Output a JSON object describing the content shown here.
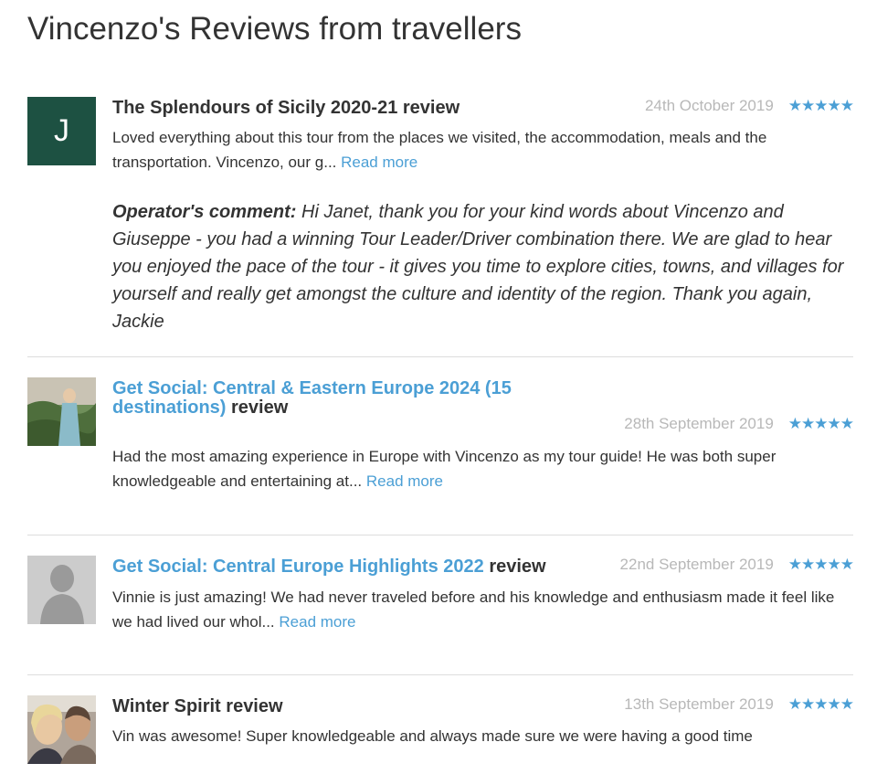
{
  "page_title": "Vincenzo's Reviews from travellers",
  "colors": {
    "accent": "#4b9fd5",
    "date": "#b8b8b8",
    "avatar_initial_bg": "#1d5142"
  },
  "reviews": [
    {
      "avatar_initial": "J",
      "tour_name": "The Splendours of Sicily 2020-21",
      "title_suffix": "review",
      "date": "24th October 2019",
      "stars": "★★★★★",
      "text": "Loved everything about this tour from the places we visited, the accommodation, meals and the transportation. Vincenzo, our g...",
      "read_more": "Read more",
      "operator_label": "Operator's comment:",
      "operator_text": "Hi Janet, thank you for your kind words about Vincenzo and Giuseppe - you had a winning Tour Leader/Driver combination there. We are glad to hear you enjoyed the pace of the tour - it gives you time to explore cities, towns, and villages for yourself and really get amongst the culture and identity of the region. Thank you again, Jackie"
    },
    {
      "tour_name": "Get Social: Central & Eastern Europe 2024 (15 destinations)",
      "title_suffix": "review",
      "date": "28th September 2019",
      "stars": "★★★★★",
      "text": "Had the most amazing experience in Europe with Vincenzo as my tour guide! He was both super knowledgeable and entertaining at...",
      "read_more": "Read more"
    },
    {
      "tour_name": "Get Social: Central Europe Highlights 2022",
      "title_suffix": "review",
      "date": "22nd September 2019",
      "stars": "★★★★★",
      "text": "Vinnie is just amazing! We had never traveled before and his knowledge and enthusiasm made it feel like we had lived our whol...",
      "read_more": "Read more"
    },
    {
      "tour_name": "Winter Spirit",
      "title_suffix": "review",
      "date": "13th September 2019",
      "stars": "★★★★★",
      "text": "Vin was awesome! Super knowledgeable and always made sure we were having a good time"
    }
  ]
}
